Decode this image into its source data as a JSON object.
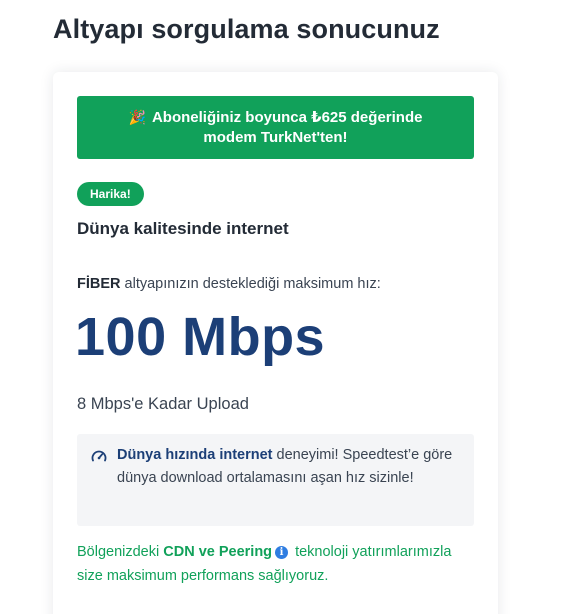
{
  "page": {
    "title": "Altyapı sorgulama sonucunuz"
  },
  "promo": {
    "icon": "party-popper-icon",
    "text": "Aboneliğiniz boyunca ₺625 değerinde modem TurkNet'ten!"
  },
  "badge": {
    "label": "Harika!"
  },
  "result": {
    "subtitle": "Dünya kalitesinde internet",
    "infra_type": "FİBER",
    "infra_suffix": " altyapınızın desteklediği maksimum hız:",
    "speed": "100 Mbps",
    "upload": "8 Mbps'e Kadar Upload"
  },
  "speedtest_box": {
    "icon": "gauge-icon",
    "bold": "Dünya hızında internet",
    "rest": " deneyimi! Speedtest’e göre dünya download ortalamasını aşan hız sizinle!"
  },
  "tech_note": {
    "prefix": "Bölgenizdeki ",
    "bold": "CDN ve Peering",
    "icon": "info-icon",
    "suffix": " teknoloji yatırımlarımızla size maksimum performans sağlıyoruz."
  },
  "colors": {
    "brand_green": "#11a15a",
    "speed_blue": "#1c3f77",
    "info_blue": "#2f7de1"
  }
}
